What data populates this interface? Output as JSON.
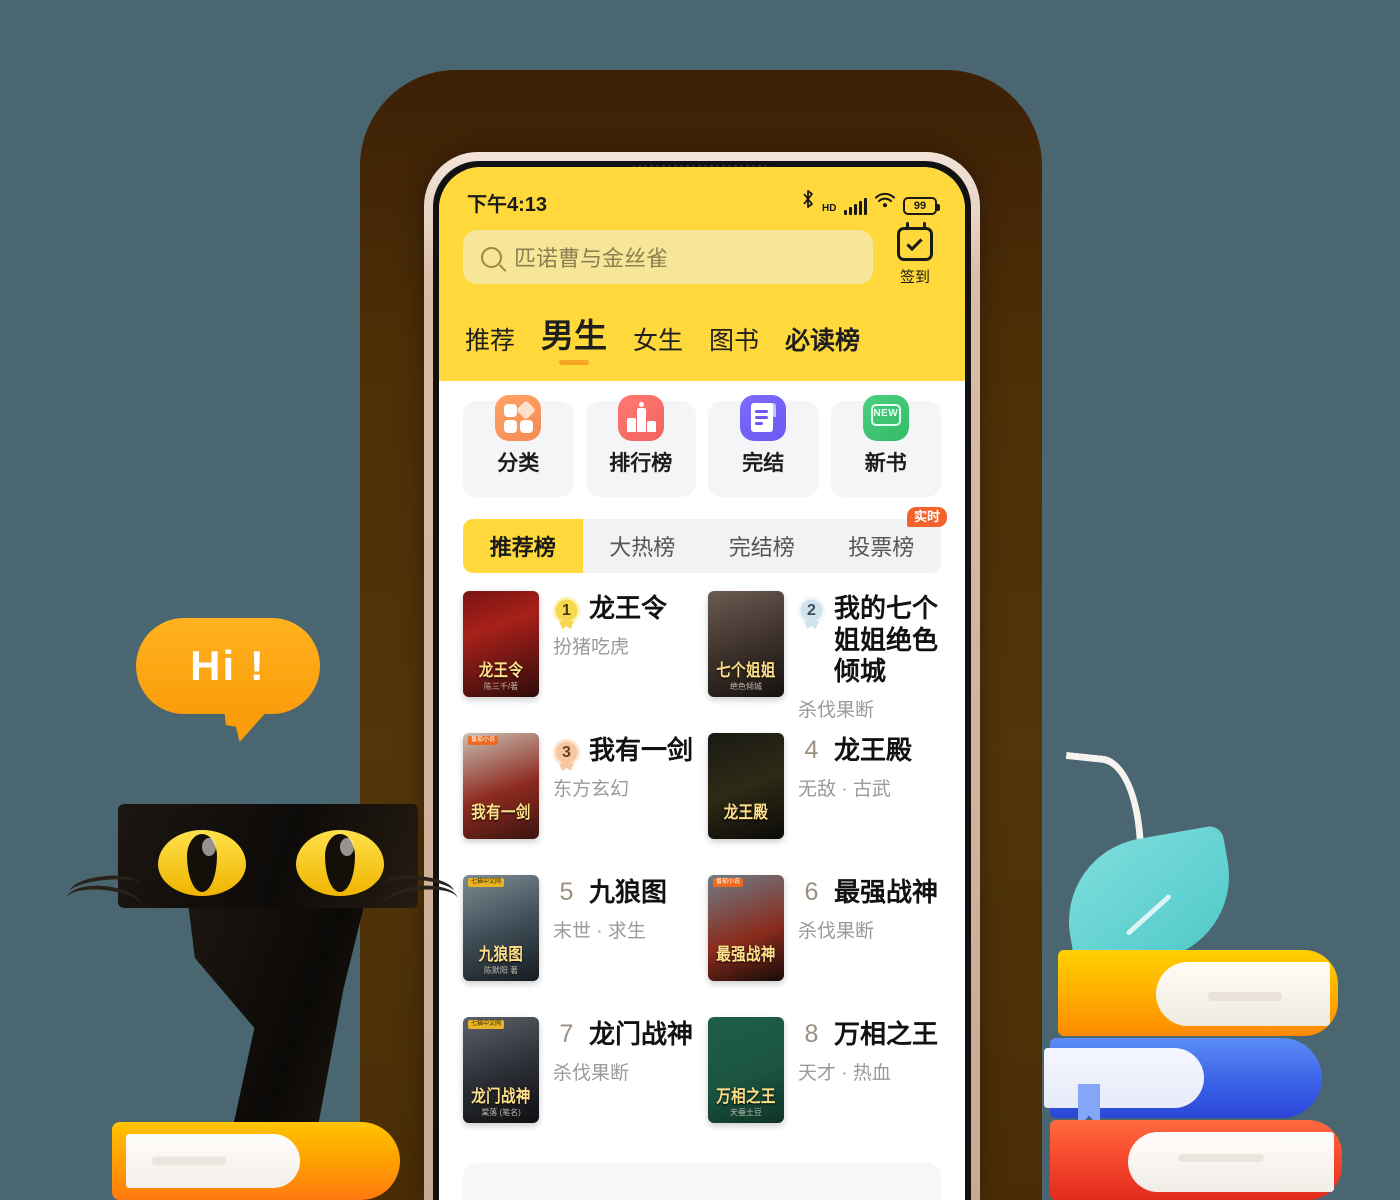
{
  "mascot": {
    "bubble_text": "Hi !"
  },
  "status_bar": {
    "time": "下午4:13",
    "hd_label": "HD",
    "battery": "99",
    "icons": [
      "bluetooth-icon",
      "hd-icon",
      "signal-icon",
      "wifi-icon",
      "battery-icon"
    ]
  },
  "search": {
    "placeholder": "匹诺曹与金丝雀",
    "icon": "search-icon"
  },
  "checkin": {
    "label": "签到",
    "icon": "calendar-check-icon"
  },
  "nav_tabs": [
    {
      "label": "推荐",
      "active": false
    },
    {
      "label": "男生",
      "active": true
    },
    {
      "label": "女生",
      "active": false
    },
    {
      "label": "图书",
      "active": false
    },
    {
      "label": "必读榜",
      "active": false,
      "accent": true
    }
  ],
  "quick_nav": [
    {
      "label": "分类",
      "icon": "grid-category-icon",
      "color": "#f79055"
    },
    {
      "label": "排行榜",
      "icon": "ranking-bars-icon",
      "color": "#f2625d"
    },
    {
      "label": "完结",
      "icon": "document-icon",
      "color": "#6a58f0"
    },
    {
      "label": "新书",
      "icon": "new-badge-icon",
      "color": "#33bb68",
      "icon_text": "NEW"
    }
  ],
  "rank_tabs": [
    {
      "label": "推荐榜",
      "active": true,
      "badge": ""
    },
    {
      "label": "大热榜",
      "active": false,
      "badge": ""
    },
    {
      "label": "完结榜",
      "active": false,
      "badge": ""
    },
    {
      "label": "投票榜",
      "active": false,
      "badge": "实时"
    }
  ],
  "books": [
    {
      "rank": "1",
      "medal": true,
      "medal_class": "g1",
      "title": "龙王令",
      "tag": "扮猪吃虎",
      "cover": {
        "title": "龙王令",
        "sub": "陈三千/著",
        "bg": "linear-gradient(160deg,#7a1412 0%,#a8201a 35%,#2e0c0a 100%)",
        "corner_tag": ""
      }
    },
    {
      "rank": "2",
      "medal": true,
      "medal_class": "g2",
      "title": "我的七个姐姐绝色倾城",
      "tag": "杀伐果断",
      "cover": {
        "title": "七个姐姐",
        "sub": "绝色倾城",
        "bg": "linear-gradient(160deg,#6b5b52 0%,#3b3029 55%,#171210 100%)",
        "corner_tag": ""
      }
    },
    {
      "rank": "3",
      "medal": true,
      "medal_class": "g3",
      "title": "我有一剑",
      "tag": "东方玄幻",
      "cover": {
        "title": "我有一剑",
        "sub": "",
        "bg": "linear-gradient(160deg,#c9bfb4 0%,#8e2a1f 55%,#3a1410 100%)",
        "corner_tag": "番茄小说"
      }
    },
    {
      "rank": "4",
      "medal": false,
      "medal_class": "",
      "title": "龙王殿",
      "tag": "无敌 · 古武",
      "cover": {
        "title": "龙王殿",
        "sub": "",
        "bg": "linear-gradient(160deg,#1a1a14 0%,#2e2a16 50%,#0b0a07 100%)",
        "corner_tag": ""
      }
    },
    {
      "rank": "5",
      "medal": false,
      "medal_class": "",
      "title": "九狼图",
      "tag": "末世 · 求生",
      "cover": {
        "title": "九狼图",
        "sub": "陈默阳 著",
        "bg": "linear-gradient(160deg,#7e8b93 0%,#424f58 50%,#151b20 100%)",
        "corner_tag": "七猫中文网"
      }
    },
    {
      "rank": "6",
      "medal": false,
      "medal_class": "",
      "title": "最强战神",
      "tag": "杀伐果断",
      "cover": {
        "title": "最强战神",
        "sub": "",
        "bg": "linear-gradient(160deg,#6d7c88 0%,#8a2b1c 58%,#160c08 100%)",
        "corner_tag": "番茄小说"
      }
    },
    {
      "rank": "7",
      "medal": false,
      "medal_class": "",
      "title": "龙门战神",
      "tag": "杀伐果断",
      "cover": {
        "title": "龙门战神",
        "sub": "棠落 (笔名)",
        "bg": "linear-gradient(160deg,#5c6068 0%,#2a2d33 55%,#0e0f12 100%)",
        "corner_tag": "七猫中文网"
      }
    },
    {
      "rank": "8",
      "medal": false,
      "medal_class": "",
      "title": "万相之王",
      "tag": "天才 · 热血",
      "cover": {
        "title": "万相之王",
        "sub": "天蚕土豆",
        "bg": "linear-gradient(160deg,#1f5e47 0%,#1b5540 55%,#0e3326 100%)",
        "corner_tag": ""
      }
    }
  ],
  "theme": {
    "header_yellow": "#ffd93b",
    "search_yellow": "#f7e697",
    "accent_orange": "#f5a623",
    "badge_orange": "#f4622b",
    "page_bg": "#4a6670"
  }
}
